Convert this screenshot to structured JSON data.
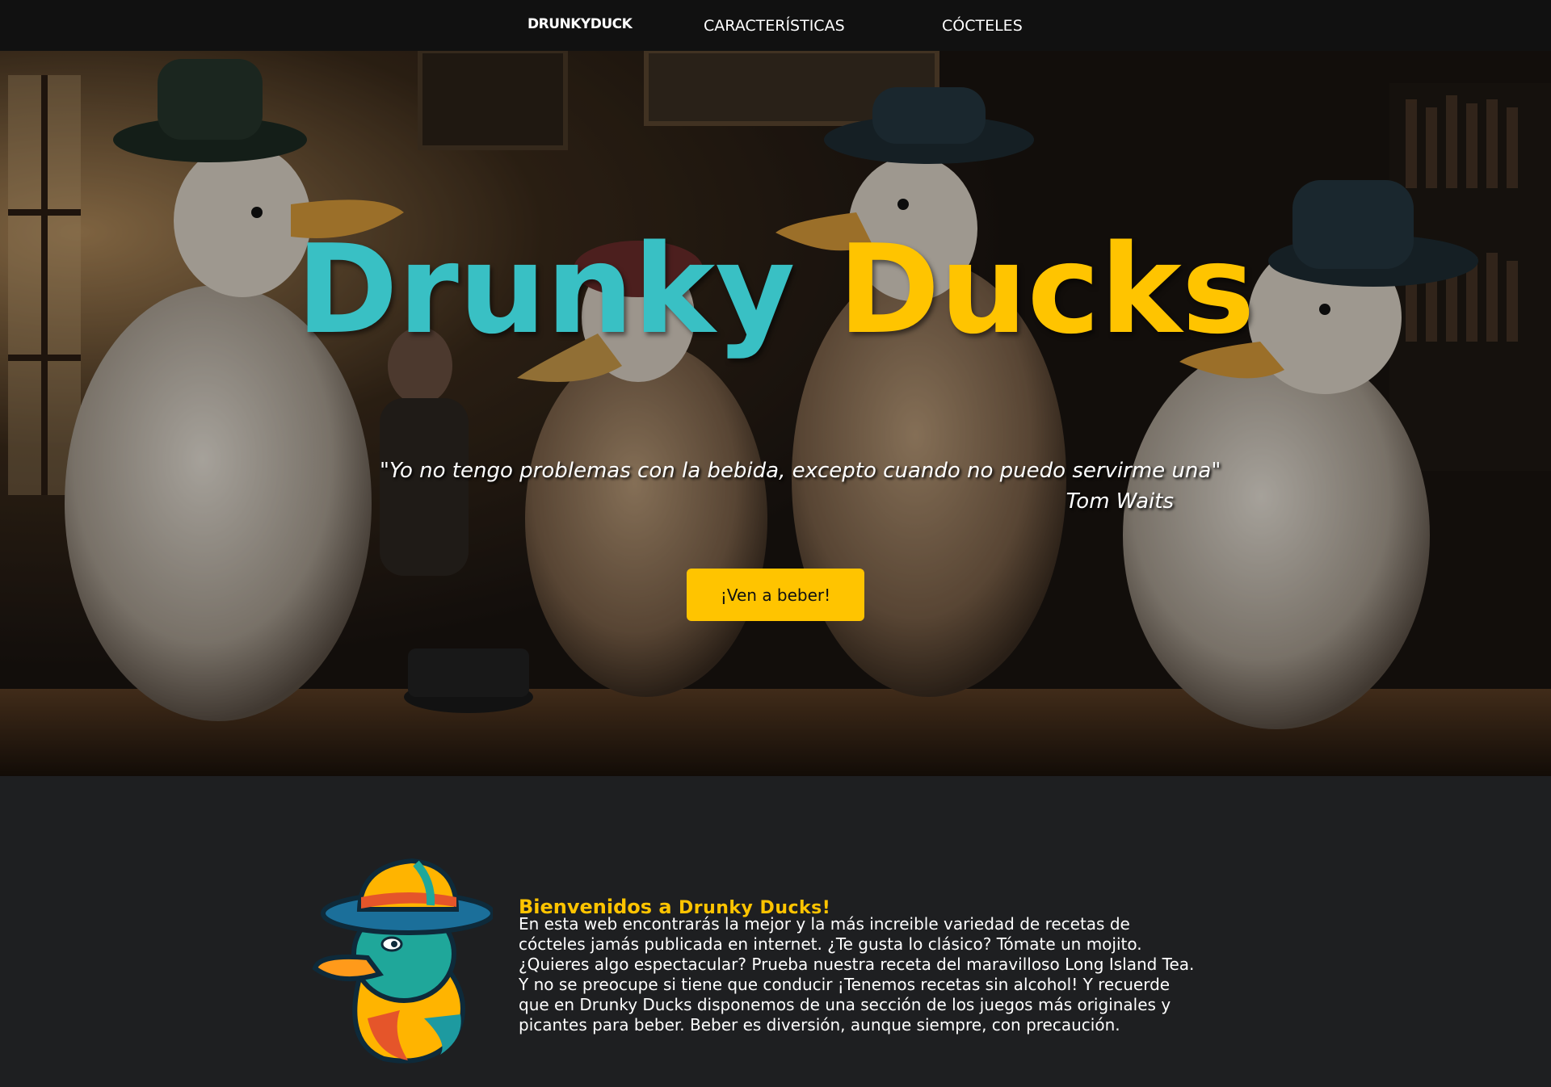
{
  "nav": {
    "logo": "DrunkyDuck",
    "links": [
      {
        "label": "CARACTERÍSTICAS"
      },
      {
        "label": "CÓCTELES"
      }
    ]
  },
  "hero": {
    "title_part_1": "Drunky",
    "title_part_2": "Ducks",
    "quote": "\"Yo no tengo problemas con la bebida, excepto cuando no puedo servirme una\"",
    "author": "Tom Waits",
    "cta_label": "¡Ven a beber!"
  },
  "welcome": {
    "heading_prefix": "Bienvenidos a ",
    "heading_brand": "Drunky Ducks!",
    "body": "En esta web encontrarás la mejor y la más increible variedad de recetas de cócteles jamás publicada en internet. ¿Te gusta lo clásico? Tómate un mojito. ¿Quieres algo espectacular? Prueba nuestra receta del maravilloso Long Island Tea. Y no se preocupe si tiene que conducir ¡Tenemos recetas sin alcohol! Y recuerde que en Drunky Ducks disponemos de una sección de los juegos más originales y picantes para beber. Beber es diversión, aunque siempre, con precaución."
  },
  "colors": {
    "accent_yellow": "#ffc400",
    "accent_teal": "#39c0c4",
    "navbar_bg": "#111111",
    "page_bg": "#1e1f21"
  }
}
